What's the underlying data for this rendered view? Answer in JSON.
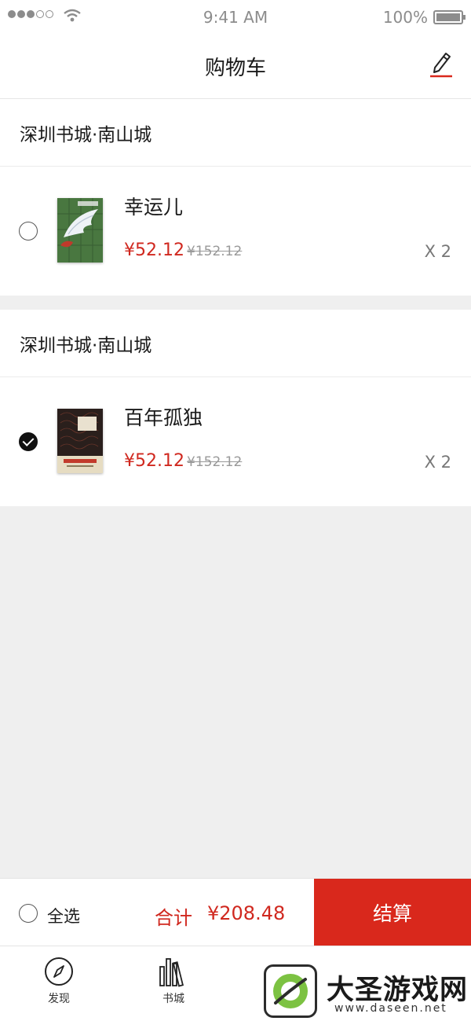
{
  "status_bar": {
    "time": "9:41 AM",
    "battery": "100%"
  },
  "nav": {
    "title": "购物车",
    "edit_icon": "pencil-icon"
  },
  "stores": [
    {
      "name": "深圳书城·南山城",
      "items": [
        {
          "title": "幸运儿",
          "price": "¥52.12",
          "original_price": "¥152.12",
          "quantity": "X 2",
          "selected": false
        }
      ]
    },
    {
      "name": "深圳书城·南山城",
      "items": [
        {
          "title": "百年孤独",
          "price": "¥52.12",
          "original_price": "¥152.12",
          "quantity": "X 2",
          "selected": true
        }
      ]
    }
  ],
  "cart_bar": {
    "select_all": "全选",
    "total_label": "合计",
    "total_value": "¥208.48",
    "checkout": "结算"
  },
  "tabs": [
    {
      "label": "发现",
      "icon": "compass-icon"
    },
    {
      "label": "书城",
      "icon": "books-icon"
    }
  ],
  "watermark": {
    "name": "大圣游戏网",
    "url": "www.daseen.net"
  },
  "colors": {
    "accent": "#d9281c",
    "price": "#d0281f",
    "background": "#efefef"
  }
}
